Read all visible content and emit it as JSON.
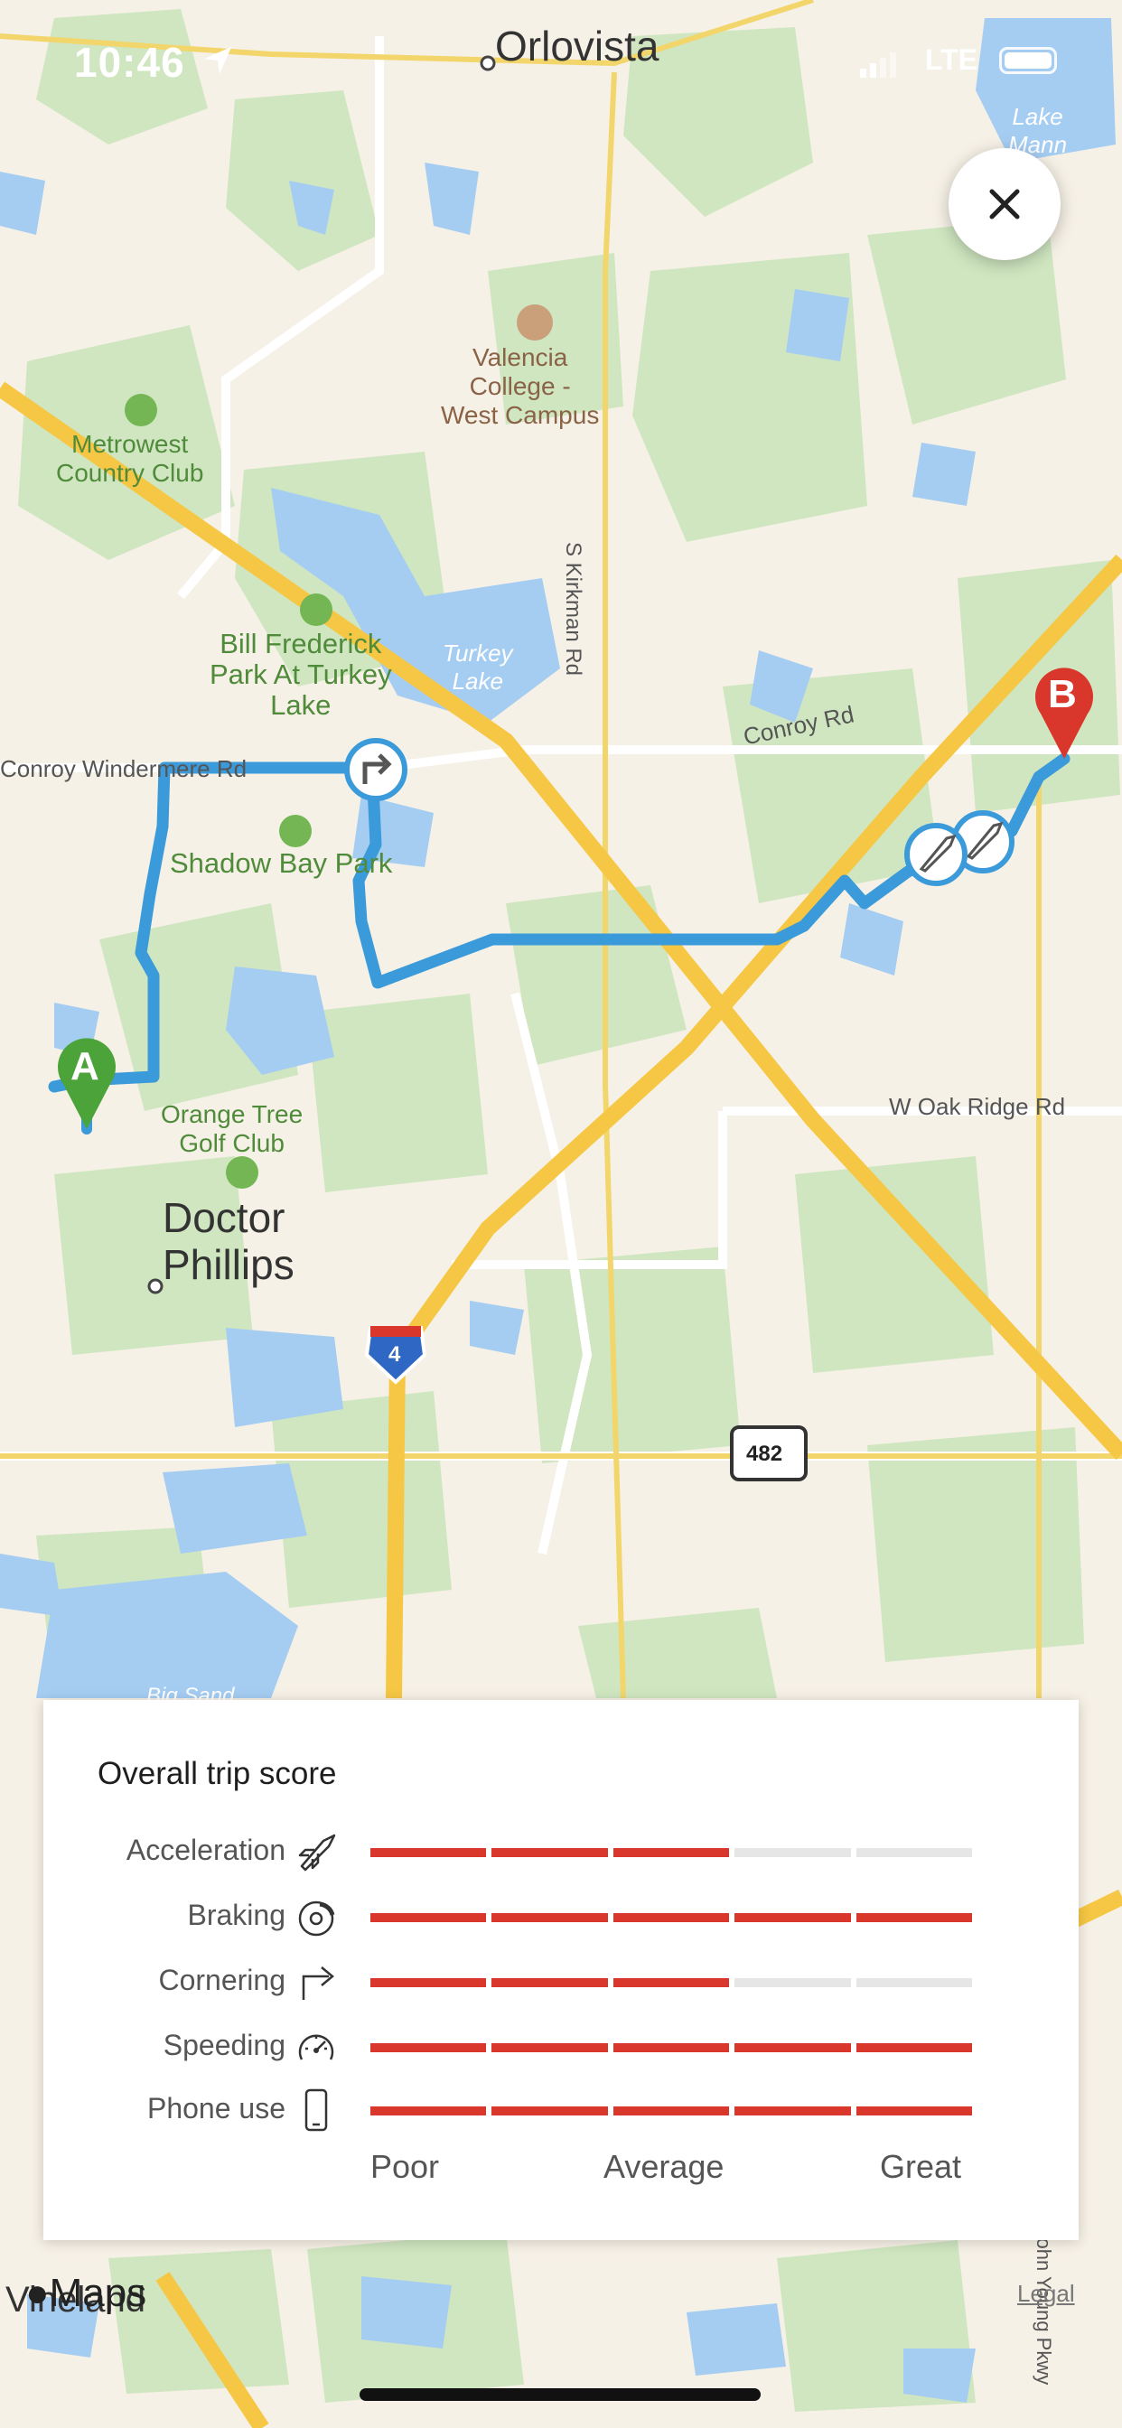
{
  "status_bar": {
    "time": "10:46",
    "network": "LTE"
  },
  "map": {
    "places": {
      "orlovista": "Orlovista",
      "lake_mann": "Lake\nMann",
      "valencia": "Valencia\nCollege -\nWest Campus",
      "metrowest": "Metrowest\nCountry Club",
      "bill_frederick": "Bill Frederick\nPark At Turkey\nLake",
      "turkey_lake": "Turkey\nLake",
      "kirkman": "S Kirkman Rd",
      "conroy": "Conroy Rd",
      "conroy_windermere": "Conroy Windermere Rd",
      "shadow_bay": "Shadow Bay Park",
      "orange_tree": "Orange Tree\nGolf Club",
      "doctor_phillips": "Doctor\nPhillips",
      "oak_ridge": "W Oak Ridge Rd",
      "i4": "4",
      "sr482": "482",
      "big_sand": "Big Sand",
      "vineland": "Vineland",
      "john_young": "S John Young Pkwy"
    },
    "markers": {
      "start": "A",
      "end": "B"
    },
    "attribution": "Maps",
    "legal": "Legal"
  },
  "score_panel": {
    "title": "Overall trip score",
    "metrics": [
      {
        "label": "Acceleration",
        "icon": "rocket-icon",
        "score": 3,
        "max": 5
      },
      {
        "label": "Braking",
        "icon": "brake-icon",
        "score": 5,
        "max": 5
      },
      {
        "label": "Cornering",
        "icon": "turn-right-icon",
        "score": 3,
        "max": 5
      },
      {
        "label": "Speeding",
        "icon": "speedometer-icon",
        "score": 5,
        "max": 5
      },
      {
        "label": "Phone use",
        "icon": "phone-icon",
        "score": 5,
        "max": 5
      }
    ],
    "scale": {
      "low": "Poor",
      "mid": "Average",
      "high": "Great"
    }
  },
  "colors": {
    "route": "#3b9ad9",
    "bar_on": "#d9372b",
    "bar_off": "#e6e6e6",
    "start_pin": "#4ca33a",
    "end_pin": "#d9372b"
  }
}
